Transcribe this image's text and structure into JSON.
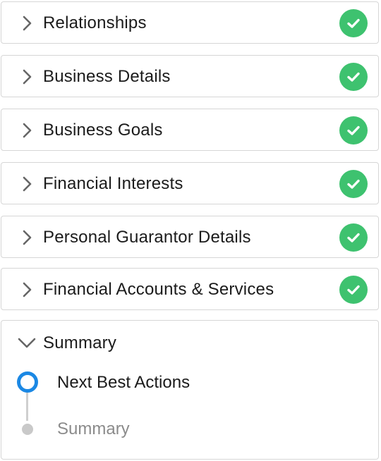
{
  "sections": [
    {
      "title": "Relationships",
      "status": "complete"
    },
    {
      "title": "Business Details",
      "status": "complete"
    },
    {
      "title": "Business Goals",
      "status": "complete"
    },
    {
      "title": "Financial Interests",
      "status": "complete"
    },
    {
      "title": "Personal Guarantor Details",
      "status": "complete"
    },
    {
      "title": "Financial Accounts & Services",
      "status": "complete"
    }
  ],
  "summary": {
    "title": "Summary",
    "steps": [
      {
        "label": "Next Best Actions",
        "state": "active"
      },
      {
        "label": "Summary",
        "state": "pending"
      }
    ]
  },
  "colors": {
    "complete": "#3ec26f",
    "active_step": "#1b88e4",
    "pending_step": "#c9c9c9",
    "border": "#d6d6d6"
  },
  "icons": {
    "collapsed": "chevron-right-icon",
    "expanded": "chevron-down-icon",
    "complete": "check-circle-icon"
  }
}
